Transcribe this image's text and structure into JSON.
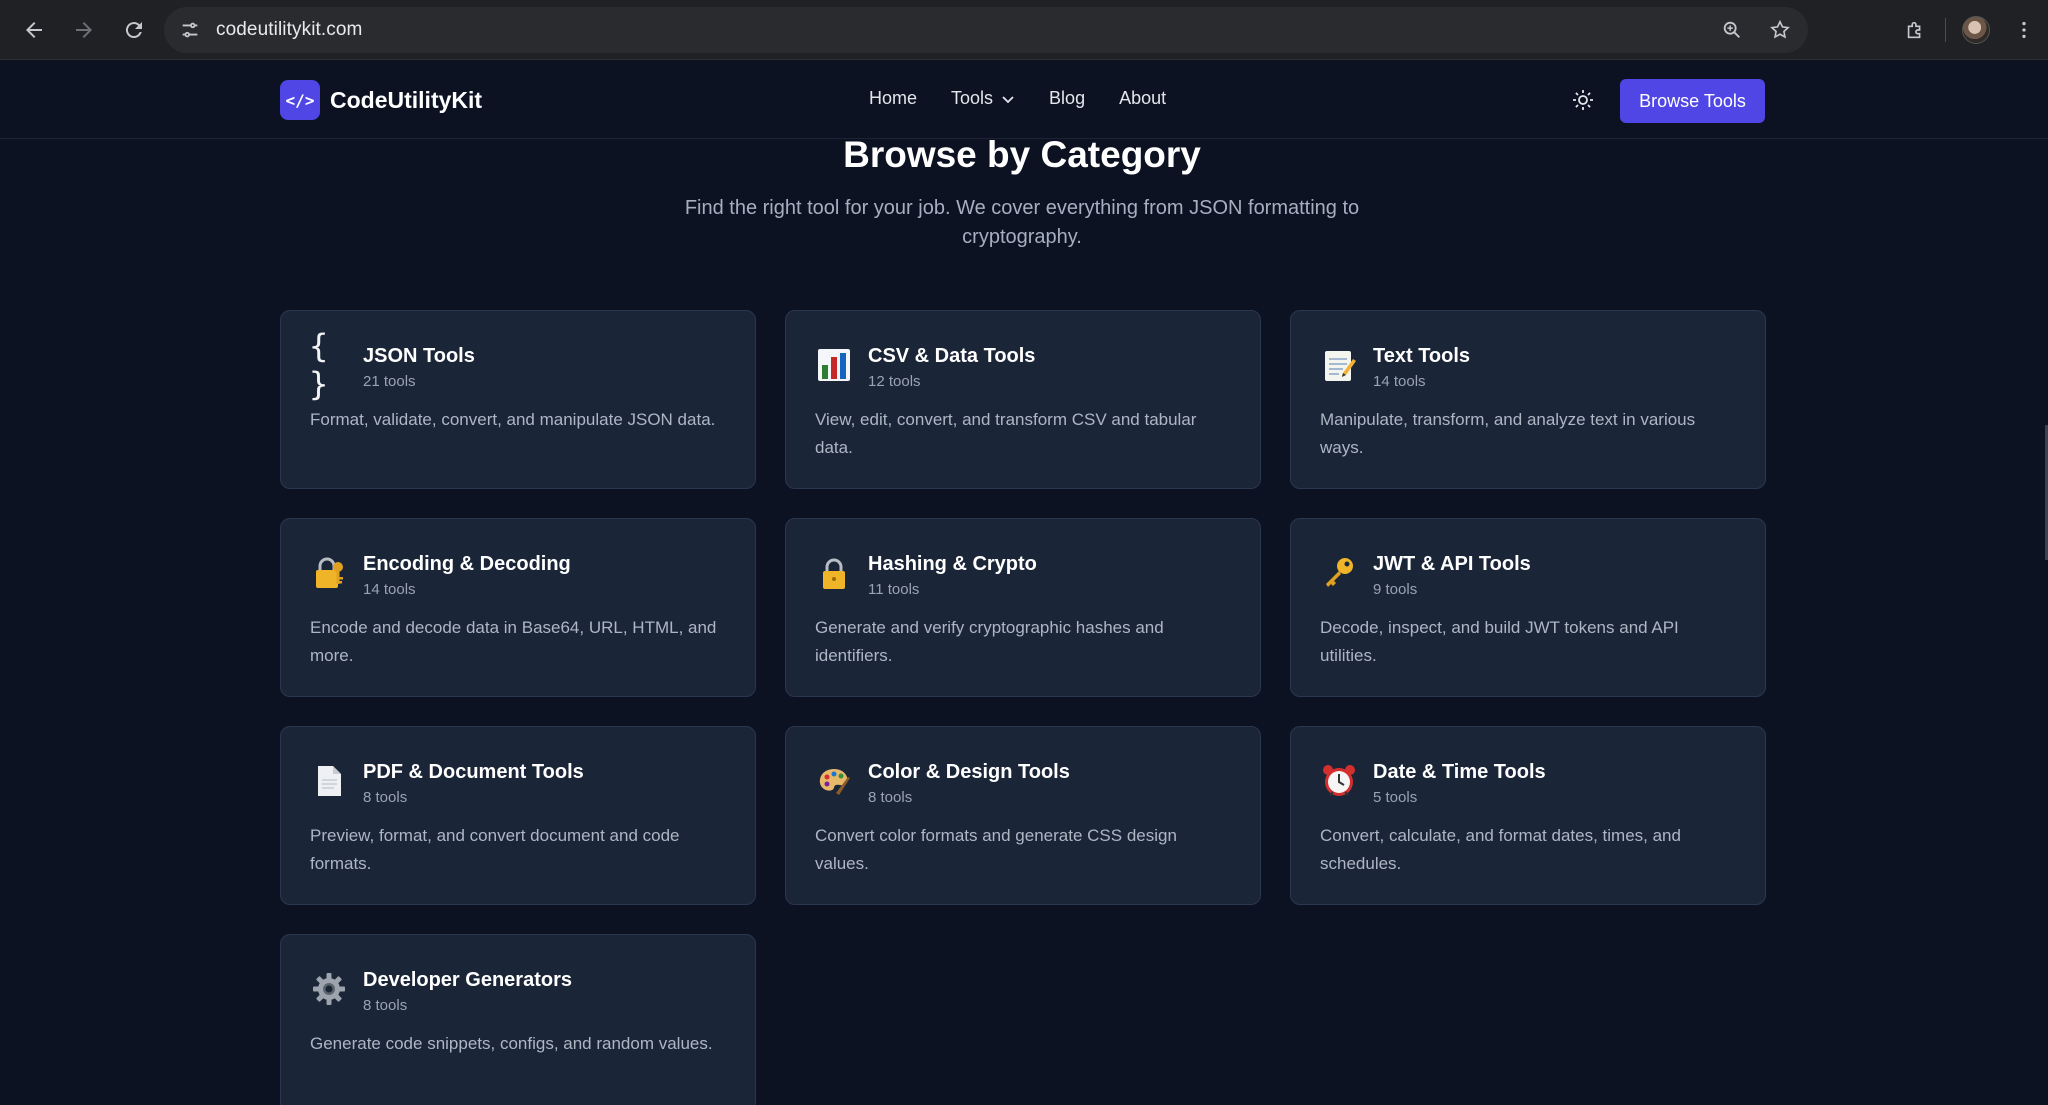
{
  "browser": {
    "url": "codeutilitykit.com"
  },
  "header": {
    "logo_mark": "</>",
    "logo_text": "CodeUtilityKit",
    "nav": [
      "Home",
      "Tools",
      "Blog",
      "About"
    ],
    "cta": "Browse Tools"
  },
  "section": {
    "title": "Browse by Category",
    "subtitle": "Find the right tool for your job. We cover everything from JSON formatting to cryptography."
  },
  "categories": [
    {
      "icon": "braces-icon",
      "title": "JSON Tools",
      "count": "21 tools",
      "description": "Format, validate, convert, and manipulate JSON data."
    },
    {
      "icon": "bar-chart-icon",
      "title": "CSV & Data Tools",
      "count": "12 tools",
      "description": "View, edit, convert, and transform CSV and tabular data."
    },
    {
      "icon": "memo-icon",
      "title": "Text Tools",
      "count": "14 tools",
      "description": "Manipulate, transform, and analyze text in various ways."
    },
    {
      "icon": "lock-with-key-icon",
      "title": "Encoding & Decoding",
      "count": "14 tools",
      "description": "Encode and decode data in Base64, URL, HTML, and more."
    },
    {
      "icon": "lock-icon",
      "title": "Hashing & Crypto",
      "count": "11 tools",
      "description": "Generate and verify cryptographic hashes and identifiers."
    },
    {
      "icon": "key-icon",
      "title": "JWT & API Tools",
      "count": "9 tools",
      "description": "Decode, inspect, and build JWT tokens and API utilities."
    },
    {
      "icon": "document-icon",
      "title": "PDF & Document Tools",
      "count": "8 tools",
      "description": "Preview, format, and convert document and code formats."
    },
    {
      "icon": "palette-icon",
      "title": "Color & Design Tools",
      "count": "8 tools",
      "description": "Convert color formats and generate CSS design values."
    },
    {
      "icon": "alarm-clock-icon",
      "title": "Date & Time Tools",
      "count": "5 tools",
      "description": "Convert, calculate, and format dates, times, and schedules."
    },
    {
      "icon": "gear-icon",
      "title": "Developer Generators",
      "count": "8 tools",
      "description": "Generate code snippets, configs, and random values."
    }
  ],
  "colors": {
    "background": "#0c1222",
    "card": "#1b2538",
    "accent": "#4f46e5"
  }
}
